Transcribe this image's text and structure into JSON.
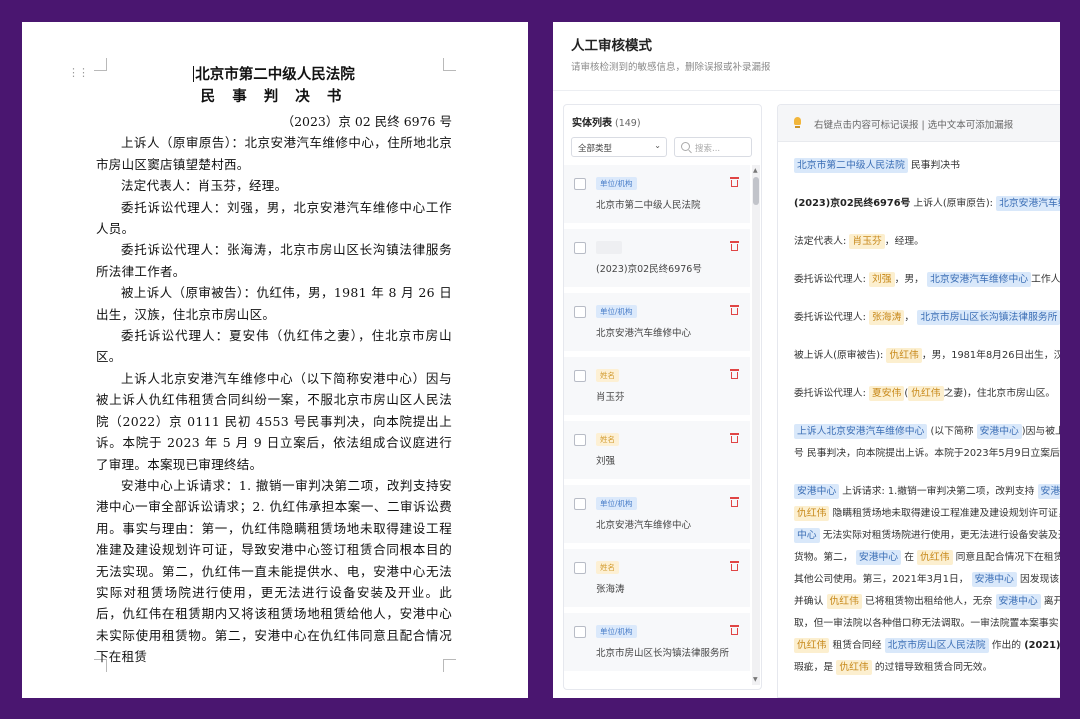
{
  "document": {
    "title_lines": [
      "北京市第二中级人民法院",
      "民 事 判 决 书"
    ],
    "case_number": "（2023）京 02 民终 6976 号",
    "paragraphs": [
      "上诉人（原审原告）：北京安港汽车维修中心，住所地北京市房山区窦店镇望楚村西。",
      "法定代表人：肖玉芬，经理。",
      "委托诉讼代理人：刘强，男，北京安港汽车维修中心工作人员。",
      "委托诉讼代理人：张海涛，北京市房山区长沟镇法律服务所法律工作者。",
      "被上诉人（原审被告）：仇红伟，男，1981 年 8 月 26 日出生，汉族，住北京市房山区。",
      "委托诉讼代理人：夏安伟（仇红伟之妻），住北京市房山区。",
      "上诉人北京安港汽车维修中心（以下简称安港中心）因与被上诉人仇红伟租赁合同纠纷一案，不服北京市房山区人民法院（2022）京 0111 民初 4553 号民事判决，向本院提出上诉。本院于 2023 年 5 月 9 日立案后，依法组成合议庭进行了审理。本案现已审理终结。",
      "安港中心上诉请求：1. 撤销一审判决第二项，改判支持安港中心一审全部诉讼请求；2. 仇红伟承担本案一、二审诉讼费用。事实与理由：第一，仇红伟隐瞒租赁场地未取得建设工程准建及建设规划许可证，导致安港中心签订租赁合同根本目的无法实现。第二，仇红伟一直未能提供水、电，安港中心无法实际对租赁场院进行使用，更无法进行设备安装及开业。此后，仇红伟在租赁期内又将该租赁场地租赁给他人，安港中心未实际使用租赁物。第二，安港中心在仇红伟同意且配合情况下在租赁"
    ]
  },
  "app": {
    "title": "人工审核模式",
    "subtitle": "请审核检测到的敏感信息，删除误报或补录漏报",
    "entity_panel": {
      "title": "实体列表",
      "count": "(149)",
      "type_filter": "全部类型",
      "search_placeholder": "搜索...",
      "items": [
        {
          "tag": "单位/机构",
          "kind": "org",
          "text": "北京市第二中级人民法院"
        },
        {
          "tag": "",
          "kind": "other",
          "text": "(2023)京02民终6976号"
        },
        {
          "tag": "单位/机构",
          "kind": "org",
          "text": "北京安港汽车维修中心"
        },
        {
          "tag": "姓名",
          "kind": "person",
          "text": "肖玉芬"
        },
        {
          "tag": "姓名",
          "kind": "person",
          "text": "刘强"
        },
        {
          "tag": "单位/机构",
          "kind": "org",
          "text": "北京安港汽车维修中心"
        },
        {
          "tag": "姓名",
          "kind": "person",
          "text": "张海涛"
        },
        {
          "tag": "单位/机构",
          "kind": "org",
          "text": "北京市房山区长沟镇法律服务所"
        }
      ]
    },
    "content_panel": {
      "hint": "右键点击内容可标记误报 | 选中文本可添加漏报",
      "lines": [
        {
          "gap": false,
          "segs": [
            {
              "t": "北京市第二中级人民法院",
              "k": "org"
            },
            {
              "t": " 民事判决书",
              "k": ""
            }
          ]
        },
        {
          "gap": true,
          "segs": []
        },
        {
          "gap": false,
          "segs": [
            {
              "t": "(2023)京02民终6976号",
              "k": "num"
            },
            {
              "t": " 上诉人(原审原告): ",
              "k": ""
            },
            {
              "t": "北京安港汽车维修中心",
              "k": "org"
            }
          ]
        },
        {
          "gap": true,
          "segs": []
        },
        {
          "gap": false,
          "segs": [
            {
              "t": "法定代表人: ",
              "k": ""
            },
            {
              "t": "肖玉芬",
              "k": "per"
            },
            {
              "t": "，经理。",
              "k": ""
            }
          ]
        },
        {
          "gap": true,
          "segs": []
        },
        {
          "gap": false,
          "segs": [
            {
              "t": "委托诉讼代理人: ",
              "k": ""
            },
            {
              "t": "刘强",
              "k": "per"
            },
            {
              "t": "，男， ",
              "k": ""
            },
            {
              "t": "北京安港汽车维修中心",
              "k": "org"
            },
            {
              "t": "工作人员。",
              "k": ""
            }
          ]
        },
        {
          "gap": true,
          "segs": []
        },
        {
          "gap": false,
          "segs": [
            {
              "t": "委托诉讼代理人: ",
              "k": ""
            },
            {
              "t": "张海涛",
              "k": "per"
            },
            {
              "t": "， ",
              "k": ""
            },
            {
              "t": "北京市房山区长沟镇法律服务所",
              "k": "org"
            }
          ]
        },
        {
          "gap": true,
          "segs": []
        },
        {
          "gap": false,
          "segs": [
            {
              "t": "被上诉人(原审被告): ",
              "k": ""
            },
            {
              "t": "仇红伟",
              "k": "per"
            },
            {
              "t": "，男，1981年8月26日出生，汉族",
              "k": ""
            }
          ]
        },
        {
          "gap": true,
          "segs": []
        },
        {
          "gap": false,
          "segs": [
            {
              "t": "委托诉讼代理人: ",
              "k": ""
            },
            {
              "t": "夏安伟",
              "k": "per"
            },
            {
              "t": "(",
              "k": ""
            },
            {
              "t": "仇红伟",
              "k": "per"
            },
            {
              "t": "之妻)，住北京市房山区。",
              "k": ""
            }
          ]
        },
        {
          "gap": true,
          "segs": []
        },
        {
          "gap": false,
          "segs": [
            {
              "t": "上诉人北京安港汽车维修中心",
              "k": "org"
            },
            {
              "t": " (以下简称 ",
              "k": ""
            },
            {
              "t": "安港中心",
              "k": "org"
            },
            {
              "t": ")因与被上诉人",
              "k": ""
            }
          ]
        },
        {
          "gap": false,
          "segs": [
            {
              "t": "号 民事判决，向本院提出上诉。本院于2023年5月9日立案后",
              "k": ""
            }
          ]
        },
        {
          "gap": true,
          "segs": []
        },
        {
          "gap": false,
          "segs": [
            {
              "t": "安港中心",
              "k": "org"
            },
            {
              "t": " 上诉请求: 1.撤销一审判决第二项，改判支持 ",
              "k": ""
            },
            {
              "t": "安港中心",
              "k": "org"
            }
          ]
        },
        {
          "gap": false,
          "segs": [
            {
              "t": "仇红伟",
              "k": "per"
            },
            {
              "t": " 隐瞒租赁场地未取得建设工程准建及建设规划许可证，导致",
              "k": ""
            }
          ]
        },
        {
          "gap": false,
          "segs": [
            {
              "t": "中心",
              "k": "org"
            },
            {
              "t": " 无法实际对租赁场院进行使用，更无法进行设备安装及开业。",
              "k": ""
            }
          ]
        },
        {
          "gap": false,
          "segs": [
            {
              "t": "货物。第二， ",
              "k": ""
            },
            {
              "t": "安港中心",
              "k": "org"
            },
            {
              "t": " 在 ",
              "k": ""
            },
            {
              "t": "仇红伟",
              "k": "per"
            },
            {
              "t": " 同意且配合情况下在租赁",
              "k": ""
            }
          ]
        },
        {
          "gap": false,
          "segs": [
            {
              "t": "其他公司使用。第三，2021年3月1日， ",
              "k": ""
            },
            {
              "t": "安港中心",
              "k": "org"
            },
            {
              "t": " 因发现该",
              "k": ""
            }
          ]
        },
        {
          "gap": false,
          "segs": [
            {
              "t": "并确认 ",
              "k": ""
            },
            {
              "t": "仇红伟",
              "k": "per"
            },
            {
              "t": " 已将租赁物出租给他人，无奈 ",
              "k": ""
            },
            {
              "t": "安港中心",
              "k": "org"
            },
            {
              "t": " 离开",
              "k": ""
            }
          ]
        },
        {
          "gap": false,
          "segs": [
            {
              "t": "取，但一审法院以各种借口称无法调取。一审法院置本案事实",
              "k": ""
            }
          ]
        },
        {
          "gap": false,
          "segs": [
            {
              "t": "仇红伟",
              "k": "per"
            },
            {
              "t": " 租赁合同经 ",
              "k": ""
            },
            {
              "t": "北京市房山区人民法院",
              "k": "org"
            },
            {
              "t": " 作出的 ",
              "k": ""
            },
            {
              "t": "(2021)",
              "k": "num"
            }
          ]
        },
        {
          "gap": false,
          "segs": [
            {
              "t": "瑕疵，是 ",
              "k": ""
            },
            {
              "t": "仇红伟",
              "k": "per"
            },
            {
              "t": " 的过错导致租赁合同无效。",
              "k": ""
            }
          ]
        }
      ]
    }
  },
  "colors": {
    "background": "#4a1670",
    "org_highlight": "#d9e8fa",
    "person_highlight": "#fcefcf",
    "delete_icon": "#e04545"
  }
}
